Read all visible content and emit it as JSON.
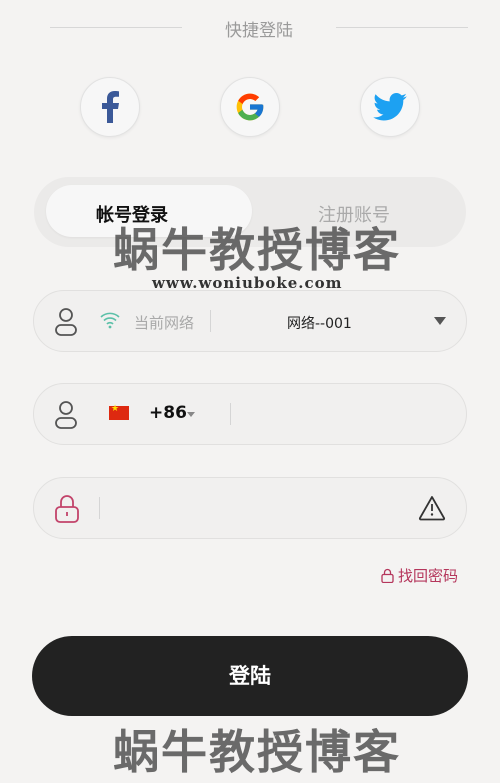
{
  "header": {
    "title": "快捷登陆"
  },
  "social": {
    "facebook": "facebook-icon",
    "google": "google-icon",
    "twitter": "twitter-icon"
  },
  "tabs": {
    "login": "帐号登录",
    "register": "注册账号"
  },
  "watermark": {
    "text": "蜗牛教授博客",
    "url": "www.woniuboke.com"
  },
  "network": {
    "label": "当前网络",
    "value": "网络--001"
  },
  "phone": {
    "country_code": "+86"
  },
  "password": {
    "value": ""
  },
  "links": {
    "forgot": "找回密码"
  },
  "login_button": "登陆",
  "colors": {
    "accent": "#b5365c",
    "button": "#222222",
    "wifi": "#5bc0a8"
  }
}
